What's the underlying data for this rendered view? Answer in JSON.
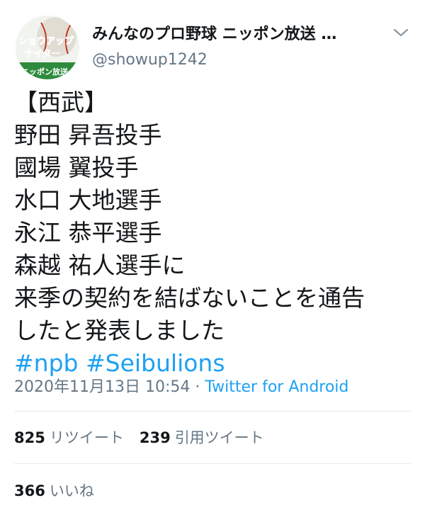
{
  "author": {
    "display_name": "みんなのプロ野球 ニッポン放送 …",
    "handle": "@showup1242",
    "avatar_text_1": "ショウアップ",
    "avatar_text_2": "ナイター",
    "avatar_text_3": "ニッポン放送"
  },
  "tweet": {
    "lines": [
      "【西武】",
      "野田 昇吾投手",
      "國場 翼投手",
      "水口 大地選手",
      "永江 恭平選手",
      "森越 祐人選手に",
      "来季の契約を結ばないことを通告",
      "したと発表しました"
    ],
    "hashtags": [
      "#npb",
      "#Seibulions"
    ]
  },
  "meta": {
    "timestamp": "2020年11月13日 10:54",
    "separator": " · ",
    "source": "Twitter for Android"
  },
  "stats": {
    "retweets_count": "825",
    "retweets_label": "リツイート",
    "quotes_count": "239",
    "quotes_label": "引用ツイート",
    "likes_count": "366",
    "likes_label": "いいね"
  },
  "colors": {
    "link": "#1da1f2",
    "muted": "#657786",
    "divider": "#e6ecf0"
  },
  "icons": {
    "more": "chevron-down-icon"
  }
}
